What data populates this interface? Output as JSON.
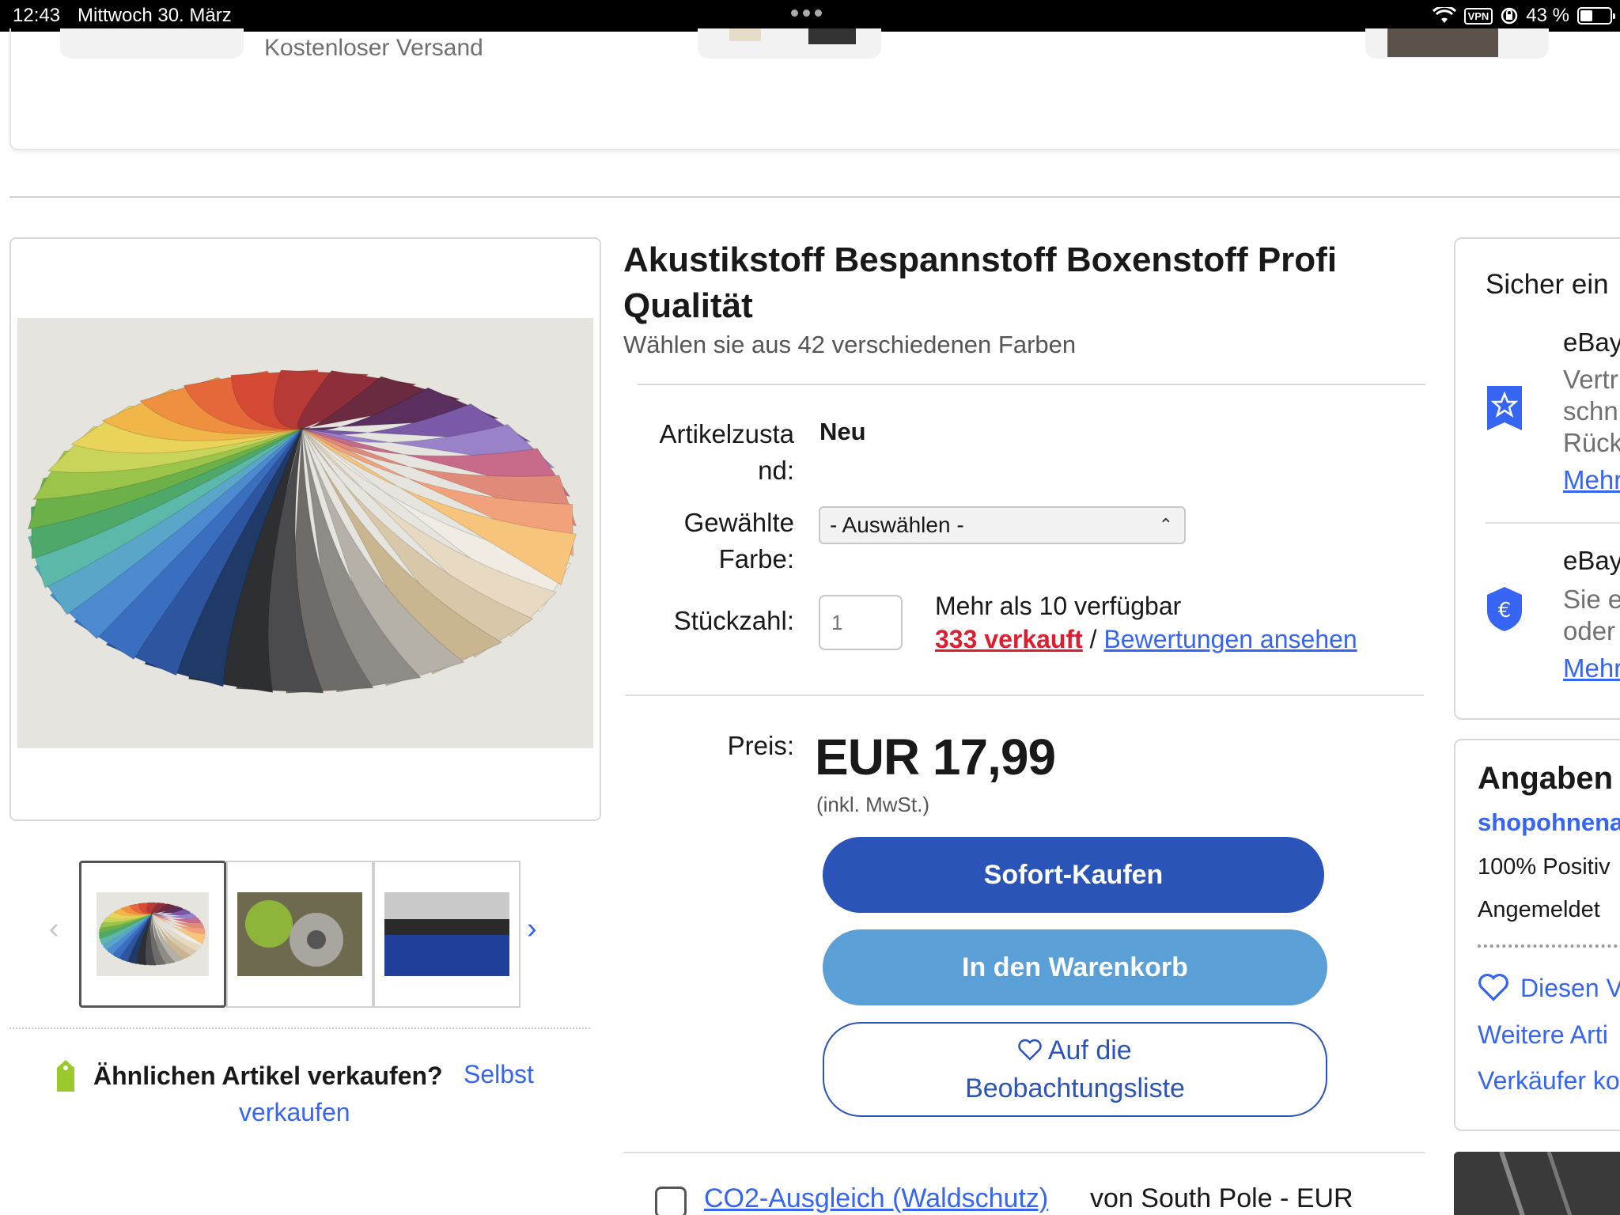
{
  "status_bar": {
    "time": "12:43",
    "date": "Mittwoch 30. März",
    "vpn": "VPN",
    "battery": "43 %",
    "battery_level": 0.43
  },
  "carousel": {
    "shipping": "Kostenloser Versand"
  },
  "product": {
    "title": "Akustikstoff Bespannstoff Boxenstoff Profi Qualität",
    "subtitle": "Wählen sie aus 42 verschiedenen Farben",
    "condition_label": "Artikelzustand:",
    "condition_value": "Neu",
    "color_label": "Gewählte Farbe:",
    "color_select": "- Auswählen -",
    "qty_label": "Stückzahl:",
    "qty_placeholder": "1",
    "available": "Mehr als 10 verfügbar",
    "sold": "333 verkauft",
    "sold_sep": "/",
    "reviews_link": "Bewertungen ansehen",
    "price_label": "Preis:",
    "price": "EUR 17,99",
    "vat": "(inkl. MwSt.)",
    "buy_now": "Sofort-Kaufen",
    "add_to_cart": "In den Warenkorb",
    "watch_line1": "Auf die",
    "watch_line2": "Beobachtungsliste",
    "co2_link": "CO2-Ausgleich (Waldschutz)",
    "co2_rest": "von South Pole - EUR"
  },
  "sell_similar": {
    "question": "Ähnlichen Artikel verkaufen?",
    "link_part1": "Selbst",
    "link_part2": "verkaufen"
  },
  "protection": {
    "heading": "Sicher ein",
    "item1_title": "eBay",
    "item1_lines": [
      "Vertr",
      "schn",
      "Rück"
    ],
    "item1_more": "Mehr",
    "item2_title": "eBay",
    "item2_lines": [
      "Sie e",
      "oder"
    ],
    "item2_more": "Mehr"
  },
  "seller": {
    "heading": "Angaben",
    "name": "shopohnena",
    "positive": "100% Positiv",
    "registered": "Angemeldet",
    "save_seller": "Diesen V",
    "more_items": "Weitere Arti",
    "contact": "Verkäufer ko"
  },
  "colors": {
    "brand_blue": "#3665f3",
    "buy_button": "#2a54b7",
    "cart_button": "#5a9fd6",
    "sold_red": "#dd1e31"
  }
}
